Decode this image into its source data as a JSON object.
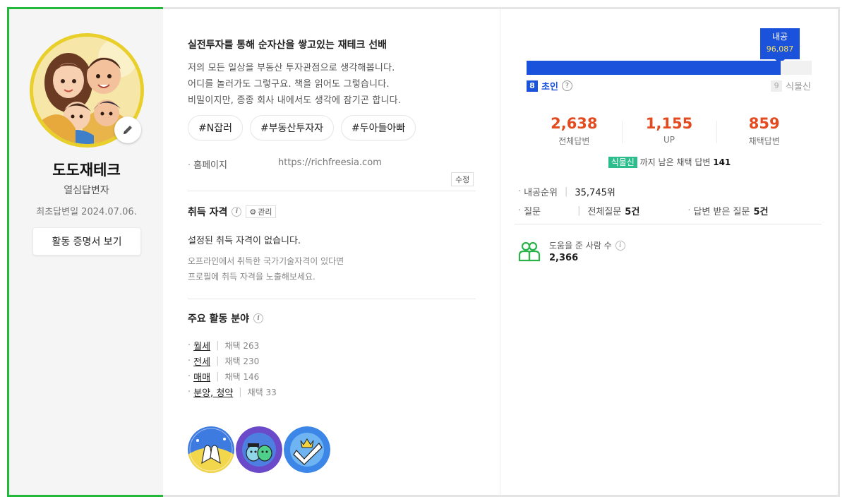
{
  "profile": {
    "nickname": "도도재테크",
    "rank_title": "열심답변자",
    "first_answer": "최초답변일 2024.07.06.",
    "cert_button": "활동 증명서 보기"
  },
  "intro": {
    "title": "실전투자를 통해 순자산을 쌓고있는 재테크 선배",
    "lines": [
      "저의 모든 일상을 부동산 투자관점으로 생각해봅니다.",
      "어디를 놀러가도 그렇구요. 책을 읽어도 그렇습니다.",
      "비밀이지만, 종종 회사 내에서도 생각에 잠기곤 합니다."
    ],
    "tags": [
      "#N잡러",
      "#부동산투자자",
      "#두아들아빠"
    ],
    "homepage_label": "홈페이지",
    "homepage_url": "https://richfreesia.com",
    "edit_label": "수정"
  },
  "certifications": {
    "title": "취득 자격",
    "manage_label": "관리",
    "none_text": "설정된 취득 자격이 없습니다.",
    "hint_lines": [
      "오프라인에서 취득한 국가기술자격이 있다면",
      "프로필에 취득 자격을 노출해보세요."
    ]
  },
  "fields": {
    "title": "주요 활동 분야",
    "items": [
      {
        "name": "월세",
        "count": "채택 263"
      },
      {
        "name": "전세",
        "count": "채택 230"
      },
      {
        "name": "매매",
        "count": "채택 146"
      },
      {
        "name": "분양, 청약",
        "count": "채택 33"
      }
    ]
  },
  "level": {
    "points_label": "내공",
    "points_value": "96,087",
    "progress_fraction": 0.89,
    "current_level_num": "8",
    "current_level_name": "초인",
    "next_level_num": "9",
    "next_level_name": "식물신",
    "help_glyph": "?"
  },
  "stats": [
    {
      "value": "2,638",
      "label": "전체답변"
    },
    {
      "value": "1,155",
      "label": "UP"
    },
    {
      "value": "859",
      "label": "채택답변"
    }
  ],
  "remain": {
    "next_tag": "식물신",
    "text": "까지 남은 채택 답변",
    "value": "141"
  },
  "meta": {
    "rank_label": "내공순위",
    "rank_value": "35,745위",
    "question_label": "질문",
    "question_total_label": "전체질문",
    "question_total_value": "5건",
    "answered_label": "답변 받은 질문",
    "answered_value": "5건"
  },
  "helped": {
    "label": "도움을 준 사람 수",
    "value": "2,366"
  },
  "colors": {
    "accent_green": "#22b83b",
    "level_blue": "#1a52dc",
    "stat_orange": "#e34a1f",
    "next_tag_green": "#2bbd8c"
  }
}
